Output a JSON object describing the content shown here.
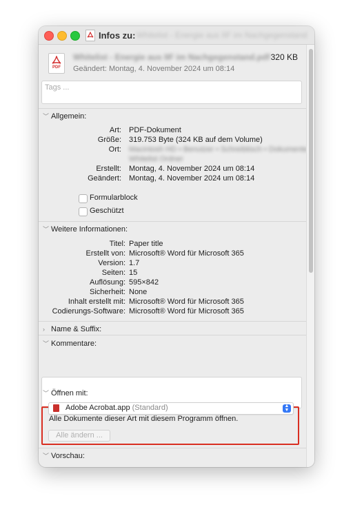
{
  "window": {
    "title_prefix": "Infos zu:",
    "title_name": "Whitelist - Energie aus IIF im Nachgegenstand"
  },
  "header": {
    "file_name": "Whitelist - Energie aus IIF im Nachgegenstand.pdf",
    "file_icon_label": "PDF",
    "size": "320 KB",
    "modified": "Geändert: Montag, 4. November 2024 um 08:14",
    "tags_placeholder": "Tags ..."
  },
  "general": {
    "heading": "Allgemein:",
    "rows": [
      {
        "key": "Art:",
        "value": "PDF-Dokument"
      },
      {
        "key": "Größe:",
        "value": "319.753 Byte (324 KB auf dem Volume)"
      },
      {
        "key": "Ort:",
        "value": "Macintosh HD • Benutzer • Schreibtisch • Dokumente"
      }
    ],
    "path_line2": "Whitelist Ordner",
    "dates": [
      {
        "key": "Erstellt:",
        "value": "Montag, 4. November 2024 um 08:14"
      },
      {
        "key": "Geändert:",
        "value": "Montag, 4. November 2024 um 08:14"
      }
    ],
    "checkboxes": [
      "Formularblock",
      "Geschützt"
    ]
  },
  "more_info": {
    "heading": "Weitere Informationen:",
    "rows": [
      {
        "key": "Titel:",
        "value": "Paper title"
      },
      {
        "key": "Erstellt von:",
        "value": "Microsoft® Word für Microsoft 365"
      },
      {
        "key": "Version:",
        "value": "1.7"
      },
      {
        "key": "Seiten:",
        "value": "15"
      },
      {
        "key": "Auflösung:",
        "value": "595×842"
      },
      {
        "key": "Sicherheit:",
        "value": "None"
      },
      {
        "key": "Inhalt erstellt mit:",
        "value": "Microsoft® Word für Microsoft 365"
      },
      {
        "key": "Codierungs-Software:",
        "value": "Microsoft® Word für Microsoft 365"
      }
    ]
  },
  "name_suffix": {
    "heading": "Name & Suffix:"
  },
  "comments": {
    "heading": "Kommentare:"
  },
  "open_with": {
    "heading": "Öffnen mit:",
    "app": "Adobe Acrobat.app",
    "app_default": "(Standard)",
    "note": "Alle Dokumente dieser Art mit diesem Programm öffnen.",
    "change_all": "Alle ändern ..."
  },
  "preview": {
    "heading": "Vorschau:"
  },
  "colors": {
    "highlight": "#d92d20",
    "pdf_red": "#d32f2f",
    "stepper_blue": "#3478f6"
  },
  "icons": [
    "close-icon",
    "minimize-icon",
    "zoom-icon",
    "pdf-icon",
    "chevron-down-icon",
    "chevron-right-icon"
  ]
}
